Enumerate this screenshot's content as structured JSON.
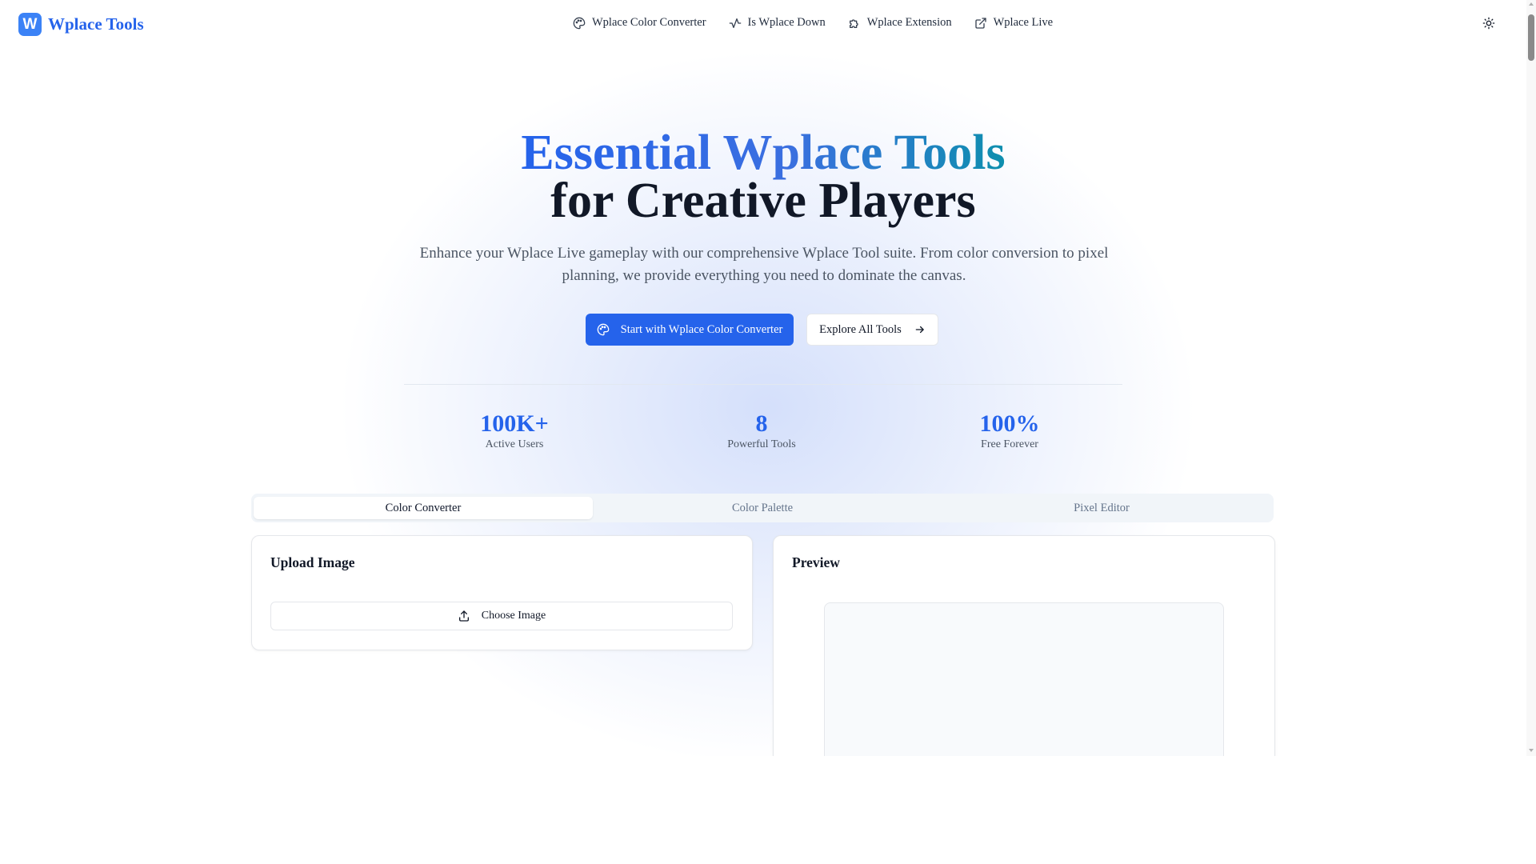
{
  "header": {
    "logo_letter": "W",
    "brand": "Wplace Tools",
    "nav": [
      {
        "label": "Wplace Color Converter",
        "icon": "palette-icon"
      },
      {
        "label": "Is Wplace Down",
        "icon": "activity-icon"
      },
      {
        "label": "Wplace Extension",
        "icon": "puzzle-icon"
      },
      {
        "label": "Wplace Live",
        "icon": "external-link-icon"
      }
    ],
    "theme_icon": "sun-icon"
  },
  "hero": {
    "title_highlight": "Essential Wplace Tools",
    "title_rest": "for Creative Players",
    "subtitle": "Enhance your Wplace Live gameplay with our comprehensive Wplace Tool suite. From color conversion to pixel planning, we provide everything you need to dominate the canvas.",
    "primary_cta": "Start with Wplace Color Converter",
    "secondary_cta": "Explore All Tools"
  },
  "stats": [
    {
      "value": "100K+",
      "label": "Active Users"
    },
    {
      "value": "8",
      "label": "Powerful Tools"
    },
    {
      "value": "100%",
      "label": "Free Forever"
    }
  ],
  "tabs": [
    {
      "label": "Color Converter",
      "active": true
    },
    {
      "label": "Color Palette",
      "active": false
    },
    {
      "label": "Pixel Editor",
      "active": false
    }
  ],
  "upload_card": {
    "title": "Upload Image",
    "button": "Choose Image"
  },
  "preview_card": {
    "title": "Preview"
  },
  "colors": {
    "accent": "#2563eb",
    "brand_mark": "#3b82f6",
    "gradient_end": "#0e8fae"
  }
}
